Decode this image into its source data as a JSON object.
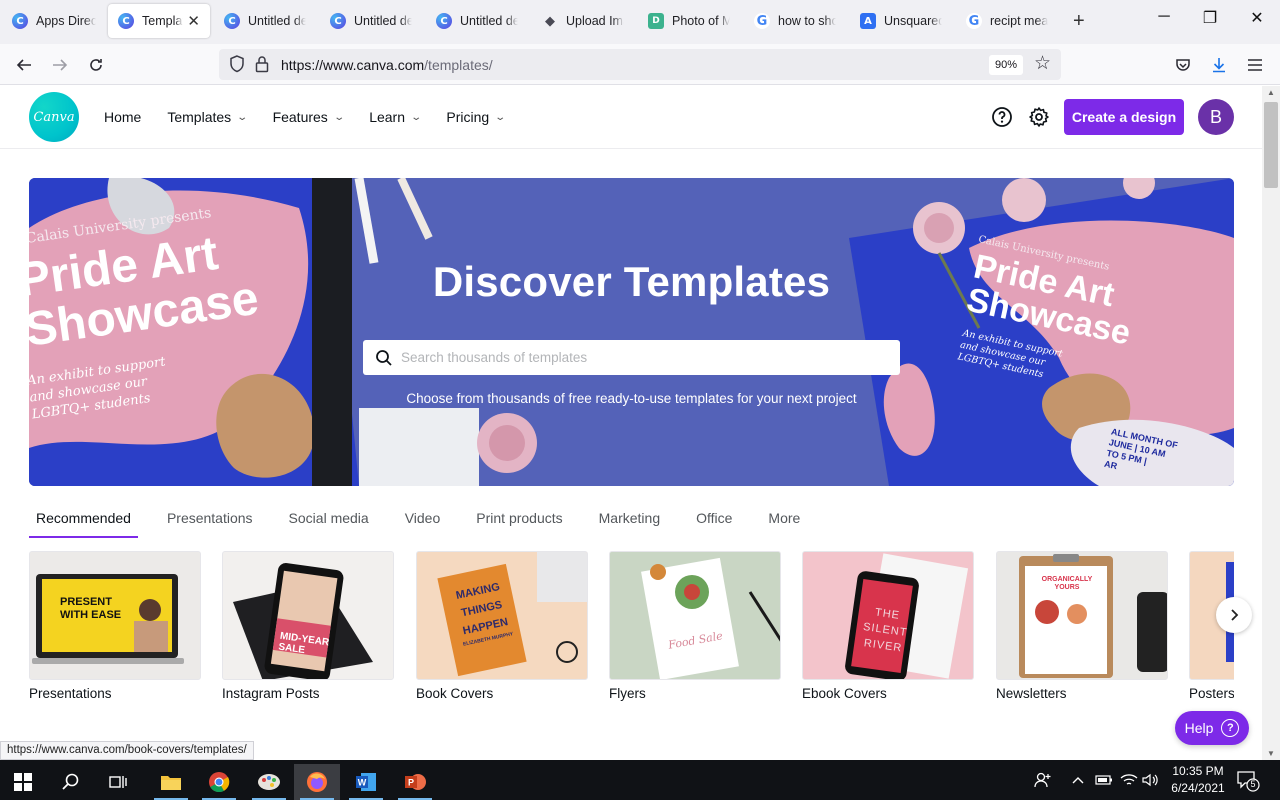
{
  "browser": {
    "tabs": [
      {
        "label": "Apps Directory",
        "favicon": "canva-icon",
        "active": false
      },
      {
        "label": "Templates",
        "favicon": "canva-icon",
        "active": true
      },
      {
        "label": "Untitled design",
        "favicon": "canva-icon",
        "active": false
      },
      {
        "label": "Untitled design",
        "favicon": "canva-icon",
        "active": false
      },
      {
        "label": "Untitled design",
        "favicon": "canva-icon",
        "active": false
      },
      {
        "label": "Upload Image",
        "favicon": "layers-icon",
        "active": false
      },
      {
        "label": "Photo of M",
        "favicon": "doc-icon",
        "active": false
      },
      {
        "label": "how to show",
        "favicon": "google-icon",
        "active": false
      },
      {
        "label": "Unsquared",
        "favicon": "unsquared-icon",
        "active": false
      },
      {
        "label": "recipt mean",
        "favicon": "google-icon",
        "active": false
      }
    ],
    "url_host": "https://www.canva.com",
    "url_path": "/templates/",
    "zoom": "90%"
  },
  "header": {
    "logo_text": "Canva",
    "nav": [
      {
        "label": "Home",
        "has_caret": false
      },
      {
        "label": "Templates",
        "has_caret": true
      },
      {
        "label": "Features",
        "has_caret": true
      },
      {
        "label": "Learn",
        "has_caret": true
      },
      {
        "label": "Pricing",
        "has_caret": true
      }
    ],
    "create_label": "Create a design",
    "avatar_initial": "B",
    "accent": "#7d2ae8"
  },
  "hero": {
    "title": "Discover Templates",
    "search_placeholder": "Search thousands of templates",
    "subtitle": "Choose from thousands of free ready-to-use templates for your next project",
    "art_left": {
      "presenter": "Calais University presents",
      "headline_1": "Pride Art",
      "headline_2": "Showcase",
      "tagline_1": "An exhibit to support",
      "tagline_2": "and showcase our",
      "tagline_3": "LGBTQ+ students"
    },
    "art_right": {
      "presenter": "Calais University presents",
      "headline_1": "Pride Art",
      "headline_2": "Showcase",
      "tagline_1": "An exhibit to support",
      "tagline_2": "and showcase our",
      "tagline_3": "LGBTQ+ students",
      "date_1": "ALL MONTH OF",
      "date_2": "JUNE | 10 AM",
      "date_3": "TO 5 PM |",
      "date_4": "AR"
    }
  },
  "categories": {
    "tabs": [
      "Recommended",
      "Presentations",
      "Social media",
      "Video",
      "Print products",
      "Marketing",
      "Office",
      "More"
    ],
    "active": "Recommended"
  },
  "cards": [
    {
      "title": "Presentations",
      "art_text_1": "PRESENT",
      "art_text_2": "WITH EASE"
    },
    {
      "title": "Instagram Posts",
      "art_text_1": "MID-YEAR",
      "art_text_2": "SALE"
    },
    {
      "title": "Book Covers",
      "art_text_1": "MAKING",
      "art_text_2": "THINGS",
      "art_text_3": "HAPPEN",
      "art_text_4": "ELIZABETH MURPHY"
    },
    {
      "title": "Flyers",
      "art_text_1": "Food Sale"
    },
    {
      "title": "Ebook Covers",
      "art_text_1": "THE",
      "art_text_2": "SILENT",
      "art_text_3": "RIVER"
    },
    {
      "title": "Newsletters",
      "art_text_1": "ORGANICALLY",
      "art_text_2": "YOURS"
    },
    {
      "title": "Posters"
    }
  ],
  "help_label": "Help",
  "help_glyph": "?",
  "status_url": "https://www.canva.com/book-covers/templates/",
  "taskbar": {
    "time": "10:35 PM",
    "date": "6/24/2021",
    "notification_count": "5"
  }
}
